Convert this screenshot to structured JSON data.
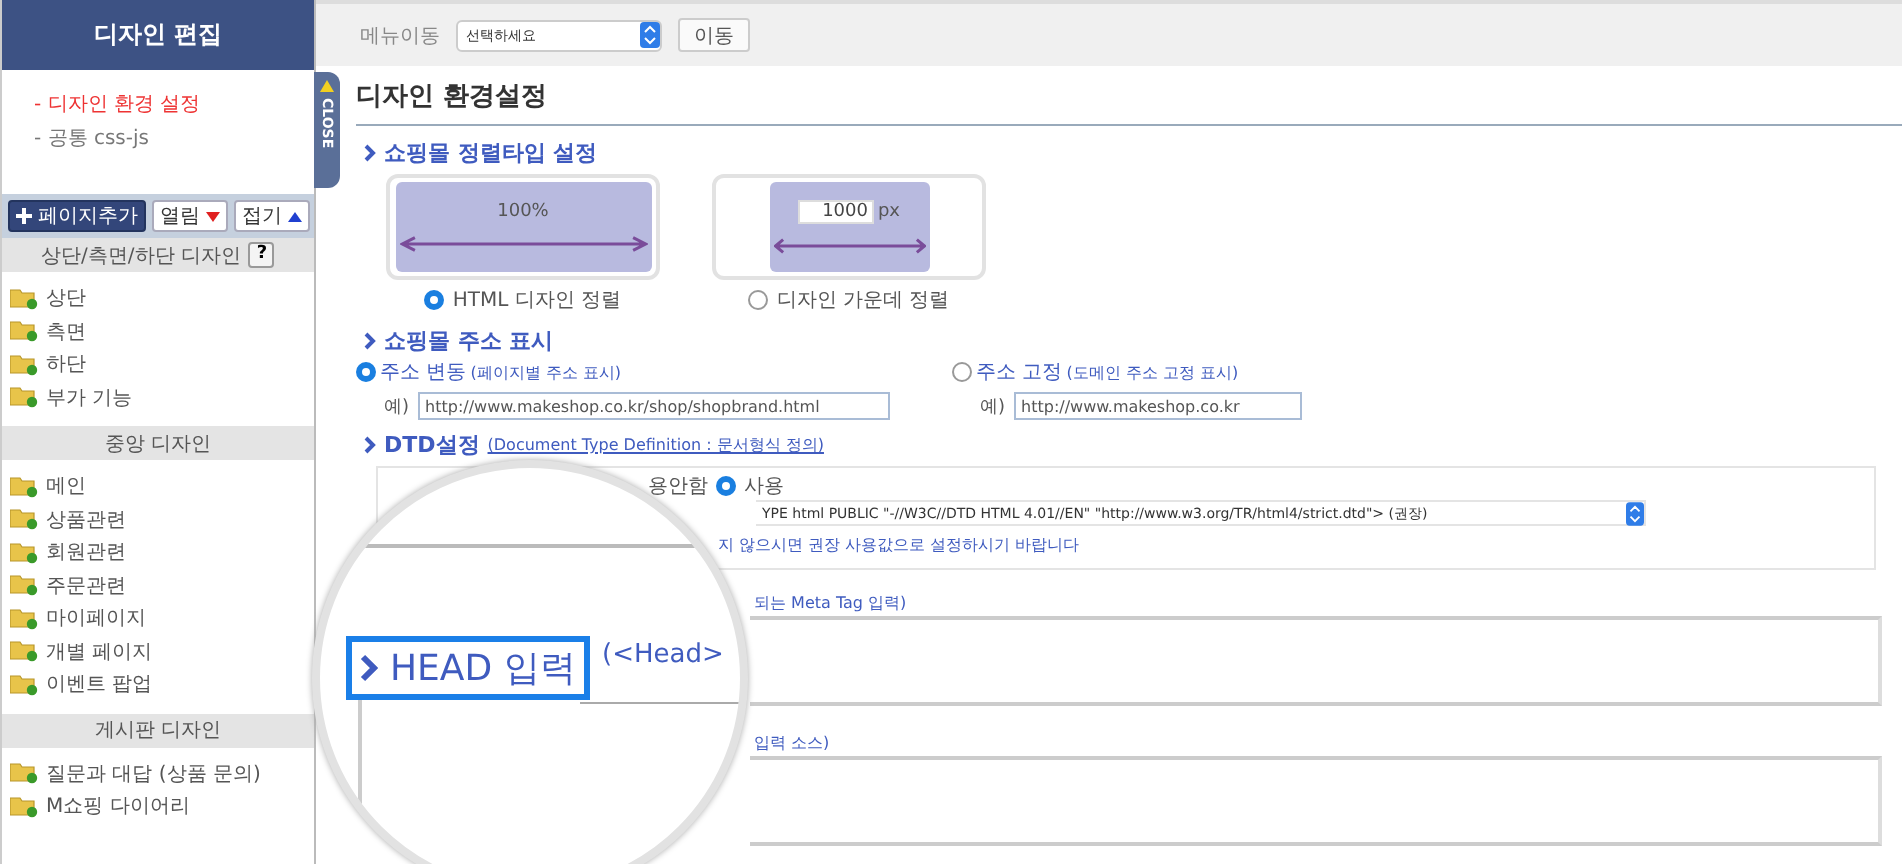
{
  "sidebar": {
    "title": "디자인 편집",
    "links": [
      {
        "label": "- 디자인 환경 설정",
        "selected": true
      },
      {
        "label": "- 공통 css-js",
        "selected": false
      }
    ],
    "toolbar": [
      {
        "label": "페이지추가",
        "kind": "add"
      },
      {
        "label": "열림",
        "kind": "down"
      },
      {
        "label": "접기",
        "kind": "up"
      }
    ],
    "sections": [
      {
        "title": "상단/측면/하단 디자인",
        "help": "?",
        "items": [
          "상단",
          "측면",
          "하단",
          "부가 기능"
        ]
      },
      {
        "title": "중앙 디자인",
        "items": [
          "메인",
          "상품관련",
          "회원관련",
          "주문관련",
          "마이페이지",
          "개별 페이지",
          "이벤트 팝업"
        ]
      },
      {
        "title": "게시판 디자인",
        "items": [
          "질문과 대답 (상품 문의)",
          "M쇼핑 다이어리"
        ]
      }
    ]
  },
  "close_tab": "CLOSE",
  "topbar": {
    "label": "메뉴이동",
    "select": "선택하세요",
    "button": "이동"
  },
  "page_title": "디자인 환경설정",
  "layout_type": {
    "heading": "쇼핑몰 정렬타입 설정",
    "options": [
      {
        "kind": "full",
        "label": "HTML 디자인 정렬",
        "selected": true,
        "width_text": "100%"
      },
      {
        "kind": "fixed",
        "label": "디자인 가운데 정렬",
        "selected": false,
        "width_value": "1000",
        "unit": "px"
      }
    ]
  },
  "address": {
    "heading": "쇼핑몰 주소 표시",
    "options": [
      {
        "label": "주소 변동",
        "note": "(페이지별 주소 표시)",
        "selected": true,
        "example_label": "예)",
        "example_value": "http://www.makeshop.co.kr/shop/shopbrand.html"
      },
      {
        "label": "주소 고정",
        "note": "(도메인 주소 고정 표시)",
        "selected": false,
        "example_label": "예)",
        "example_value": "http://www.makeshop.co.kr"
      }
    ]
  },
  "dtd": {
    "heading": "DTD설정",
    "subtitle": "(Document Type Definition : 문서형식 정의)",
    "off_fragment": "용안함",
    "on_option": {
      "label": "사용",
      "selected": true
    },
    "select_fragment": "YPE html PUBLIC \"-//W3C//DTD HTML 4.01//EN\" \"http://www.w3.org/TR/html4/strict.dtd\"> (권장)",
    "note_fragment": "지 않으시면 권장 사용값으로 설정하시기 바랍니다"
  },
  "meta": {
    "caption_fragment": "되는 Meta Tag 입력)"
  },
  "source": {
    "caption_fragment": "입력 소스)"
  },
  "magnifier": {
    "heading": "HEAD 입력",
    "fragment": "(<Head>"
  }
}
